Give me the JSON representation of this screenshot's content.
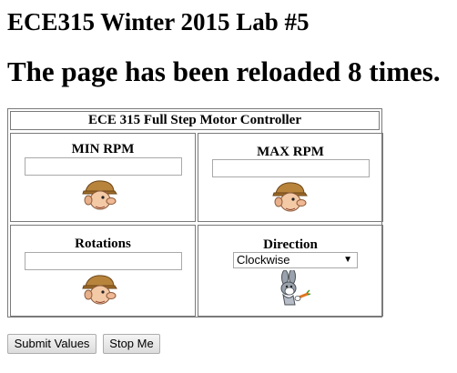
{
  "header": {
    "title": "ECE315 Winter 2015 Lab #5",
    "reload_message": "The page has been reloaded 8 times."
  },
  "controller": {
    "caption": "ECE 315 Full Step Motor Controller",
    "min_rpm": {
      "label": "MIN RPM",
      "value": "",
      "icon": "elmer-fudd-icon"
    },
    "max_rpm": {
      "label": "MAX RPM",
      "value": "",
      "icon": "elmer-fudd-icon"
    },
    "rotations": {
      "label": "Rotations",
      "value": "",
      "icon": "elmer-fudd-icon"
    },
    "direction": {
      "label": "Direction",
      "selected": "Clockwise",
      "icon": "bugs-bunny-icon"
    }
  },
  "buttons": {
    "submit_label": "Submit Values",
    "stop_label": "Stop Me"
  }
}
